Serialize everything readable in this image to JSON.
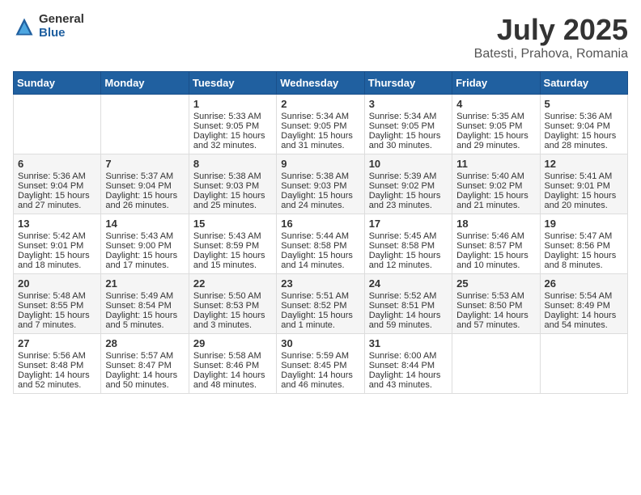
{
  "logo": {
    "general": "General",
    "blue": "Blue"
  },
  "title": "July 2025",
  "subtitle": "Batesti, Prahova, Romania",
  "days": [
    "Sunday",
    "Monday",
    "Tuesday",
    "Wednesday",
    "Thursday",
    "Friday",
    "Saturday"
  ],
  "weeks": [
    [
      {
        "day": "",
        "sunrise": "",
        "sunset": "",
        "daylight": ""
      },
      {
        "day": "",
        "sunrise": "",
        "sunset": "",
        "daylight": ""
      },
      {
        "day": "1",
        "sunrise": "Sunrise: 5:33 AM",
        "sunset": "Sunset: 9:05 PM",
        "daylight": "Daylight: 15 hours and 32 minutes."
      },
      {
        "day": "2",
        "sunrise": "Sunrise: 5:34 AM",
        "sunset": "Sunset: 9:05 PM",
        "daylight": "Daylight: 15 hours and 31 minutes."
      },
      {
        "day": "3",
        "sunrise": "Sunrise: 5:34 AM",
        "sunset": "Sunset: 9:05 PM",
        "daylight": "Daylight: 15 hours and 30 minutes."
      },
      {
        "day": "4",
        "sunrise": "Sunrise: 5:35 AM",
        "sunset": "Sunset: 9:05 PM",
        "daylight": "Daylight: 15 hours and 29 minutes."
      },
      {
        "day": "5",
        "sunrise": "Sunrise: 5:36 AM",
        "sunset": "Sunset: 9:04 PM",
        "daylight": "Daylight: 15 hours and 28 minutes."
      }
    ],
    [
      {
        "day": "6",
        "sunrise": "Sunrise: 5:36 AM",
        "sunset": "Sunset: 9:04 PM",
        "daylight": "Daylight: 15 hours and 27 minutes."
      },
      {
        "day": "7",
        "sunrise": "Sunrise: 5:37 AM",
        "sunset": "Sunset: 9:04 PM",
        "daylight": "Daylight: 15 hours and 26 minutes."
      },
      {
        "day": "8",
        "sunrise": "Sunrise: 5:38 AM",
        "sunset": "Sunset: 9:03 PM",
        "daylight": "Daylight: 15 hours and 25 minutes."
      },
      {
        "day": "9",
        "sunrise": "Sunrise: 5:38 AM",
        "sunset": "Sunset: 9:03 PM",
        "daylight": "Daylight: 15 hours and 24 minutes."
      },
      {
        "day": "10",
        "sunrise": "Sunrise: 5:39 AM",
        "sunset": "Sunset: 9:02 PM",
        "daylight": "Daylight: 15 hours and 23 minutes."
      },
      {
        "day": "11",
        "sunrise": "Sunrise: 5:40 AM",
        "sunset": "Sunset: 9:02 PM",
        "daylight": "Daylight: 15 hours and 21 minutes."
      },
      {
        "day": "12",
        "sunrise": "Sunrise: 5:41 AM",
        "sunset": "Sunset: 9:01 PM",
        "daylight": "Daylight: 15 hours and 20 minutes."
      }
    ],
    [
      {
        "day": "13",
        "sunrise": "Sunrise: 5:42 AM",
        "sunset": "Sunset: 9:01 PM",
        "daylight": "Daylight: 15 hours and 18 minutes."
      },
      {
        "day": "14",
        "sunrise": "Sunrise: 5:43 AM",
        "sunset": "Sunset: 9:00 PM",
        "daylight": "Daylight: 15 hours and 17 minutes."
      },
      {
        "day": "15",
        "sunrise": "Sunrise: 5:43 AM",
        "sunset": "Sunset: 8:59 PM",
        "daylight": "Daylight: 15 hours and 15 minutes."
      },
      {
        "day": "16",
        "sunrise": "Sunrise: 5:44 AM",
        "sunset": "Sunset: 8:58 PM",
        "daylight": "Daylight: 15 hours and 14 minutes."
      },
      {
        "day": "17",
        "sunrise": "Sunrise: 5:45 AM",
        "sunset": "Sunset: 8:58 PM",
        "daylight": "Daylight: 15 hours and 12 minutes."
      },
      {
        "day": "18",
        "sunrise": "Sunrise: 5:46 AM",
        "sunset": "Sunset: 8:57 PM",
        "daylight": "Daylight: 15 hours and 10 minutes."
      },
      {
        "day": "19",
        "sunrise": "Sunrise: 5:47 AM",
        "sunset": "Sunset: 8:56 PM",
        "daylight": "Daylight: 15 hours and 8 minutes."
      }
    ],
    [
      {
        "day": "20",
        "sunrise": "Sunrise: 5:48 AM",
        "sunset": "Sunset: 8:55 PM",
        "daylight": "Daylight: 15 hours and 7 minutes."
      },
      {
        "day": "21",
        "sunrise": "Sunrise: 5:49 AM",
        "sunset": "Sunset: 8:54 PM",
        "daylight": "Daylight: 15 hours and 5 minutes."
      },
      {
        "day": "22",
        "sunrise": "Sunrise: 5:50 AM",
        "sunset": "Sunset: 8:53 PM",
        "daylight": "Daylight: 15 hours and 3 minutes."
      },
      {
        "day": "23",
        "sunrise": "Sunrise: 5:51 AM",
        "sunset": "Sunset: 8:52 PM",
        "daylight": "Daylight: 15 hours and 1 minute."
      },
      {
        "day": "24",
        "sunrise": "Sunrise: 5:52 AM",
        "sunset": "Sunset: 8:51 PM",
        "daylight": "Daylight: 14 hours and 59 minutes."
      },
      {
        "day": "25",
        "sunrise": "Sunrise: 5:53 AM",
        "sunset": "Sunset: 8:50 PM",
        "daylight": "Daylight: 14 hours and 57 minutes."
      },
      {
        "day": "26",
        "sunrise": "Sunrise: 5:54 AM",
        "sunset": "Sunset: 8:49 PM",
        "daylight": "Daylight: 14 hours and 54 minutes."
      }
    ],
    [
      {
        "day": "27",
        "sunrise": "Sunrise: 5:56 AM",
        "sunset": "Sunset: 8:48 PM",
        "daylight": "Daylight: 14 hours and 52 minutes."
      },
      {
        "day": "28",
        "sunrise": "Sunrise: 5:57 AM",
        "sunset": "Sunset: 8:47 PM",
        "daylight": "Daylight: 14 hours and 50 minutes."
      },
      {
        "day": "29",
        "sunrise": "Sunrise: 5:58 AM",
        "sunset": "Sunset: 8:46 PM",
        "daylight": "Daylight: 14 hours and 48 minutes."
      },
      {
        "day": "30",
        "sunrise": "Sunrise: 5:59 AM",
        "sunset": "Sunset: 8:45 PM",
        "daylight": "Daylight: 14 hours and 46 minutes."
      },
      {
        "day": "31",
        "sunrise": "Sunrise: 6:00 AM",
        "sunset": "Sunset: 8:44 PM",
        "daylight": "Daylight: 14 hours and 43 minutes."
      },
      {
        "day": "",
        "sunrise": "",
        "sunset": "",
        "daylight": ""
      },
      {
        "day": "",
        "sunrise": "",
        "sunset": "",
        "daylight": ""
      }
    ]
  ]
}
